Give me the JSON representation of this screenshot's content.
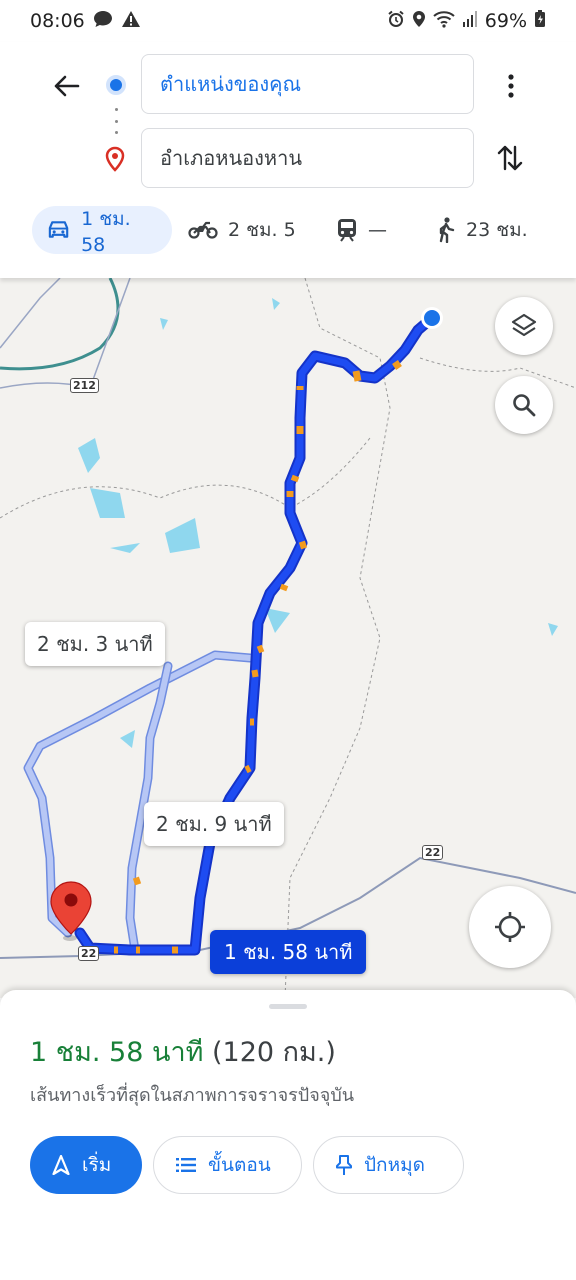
{
  "status_bar": {
    "time": "08:06",
    "battery": "69%",
    "icons": [
      "chat-bubble-icon",
      "warning-icon",
      "alarm-icon",
      "location-icon",
      "wifi-icon",
      "signal-icon",
      "battery-icon"
    ]
  },
  "route_panel": {
    "origin": "ตำแหน่งของคุณ",
    "destination": "อำเภอหนองหาน",
    "modes": [
      {
        "icon": "car-icon",
        "label": "1 ชม. 58",
        "active": true
      },
      {
        "icon": "motorcycle-icon",
        "label": "2 ชม. 5",
        "active": false
      },
      {
        "icon": "train-icon",
        "label": "—",
        "active": false
      },
      {
        "icon": "walk-icon",
        "label": "23 ชม.",
        "active": false
      }
    ]
  },
  "map": {
    "route_labels": {
      "main": "1 ชม. 58 นาที",
      "alt1": "2 ชม. 3 นาที",
      "alt2": "2 ชม. 9 นาที"
    },
    "road_shields": [
      "212",
      "22",
      "22"
    ],
    "colors": {
      "main_route": "#1a3ff0",
      "alt_route": "#a9bcf2",
      "traffic": "#f29b1f",
      "water": "#8fd7ee"
    }
  },
  "bottom_sheet": {
    "duration": "1 ชม. 58 นาที",
    "distance": "(120 กม.)",
    "subtitle": "เส้นทางเร็วที่สุดในสภาพการจราจรปัจจุบัน",
    "buttons": {
      "start": "เริ่ม",
      "steps": "ขั้นตอน",
      "pin": "ปักหมุด"
    }
  }
}
